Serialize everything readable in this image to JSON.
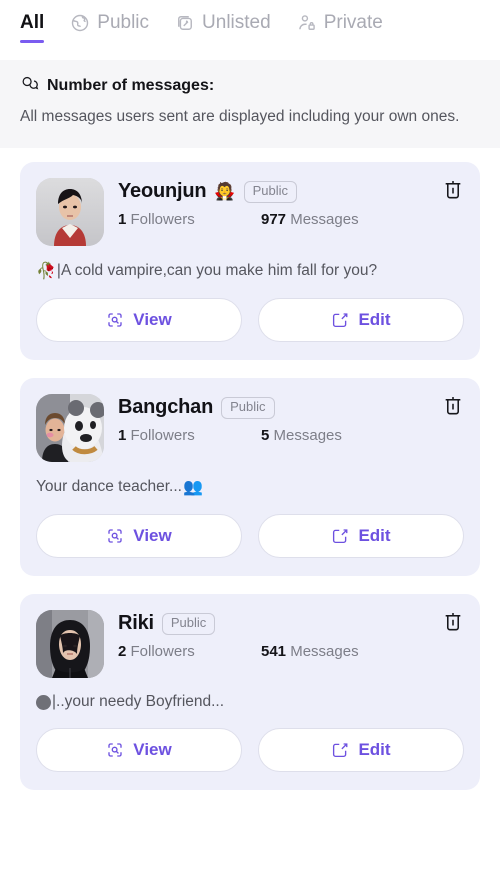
{
  "tabs": [
    {
      "label": "All",
      "icon": "",
      "active": true
    },
    {
      "label": "Public",
      "icon": "globe-icon",
      "active": false
    },
    {
      "label": "Unlisted",
      "icon": "unlisted-link-icon",
      "active": false
    },
    {
      "label": "Private",
      "icon": "person-lock-icon",
      "active": false
    }
  ],
  "banner": {
    "icon": "speech-bubbles-icon",
    "title": "Number of messages:",
    "subtitle": "All messages users sent are displayed including your own ones."
  },
  "colors": {
    "accent": "#7a5cf0",
    "button_text": "#6d51e0",
    "card_bg": "#eeeffa",
    "banner_bg": "#f6f6f8",
    "page_bg": "#ffffff",
    "muted_text": "#7d7e88"
  },
  "actions": {
    "view_label": "View",
    "view_icon": "view-square-magnifier-icon",
    "edit_label": "Edit",
    "edit_icon": "edit-pencil-square-icon",
    "delete_icon": "trash-icon"
  },
  "labels": {
    "followers": "Followers",
    "messages": "Messages"
  },
  "characters": [
    {
      "name": "Yeounjun",
      "name_emoji": "🧛",
      "visibility": "Public",
      "followers": "1",
      "followers_label": "Followers",
      "messages": "977",
      "messages_label": "Messages",
      "description": "|A cold vampire,can you make him fall for you?",
      "description_emoji": "🥀",
      "description_emoji_position": "start",
      "avatar": "yeounjun-avatar"
    },
    {
      "name": "Bangchan",
      "name_emoji": "",
      "visibility": "Public",
      "followers": "1",
      "followers_label": "Followers",
      "messages": "5",
      "messages_label": "Messages",
      "description": "Your dance teacher...",
      "description_emoji": "👥",
      "description_emoji_position": "end",
      "avatar": "bangchan-avatar"
    },
    {
      "name": "Riki",
      "name_emoji": "",
      "visibility": "Public",
      "followers": "2",
      "followers_label": "Followers",
      "messages": "541",
      "messages_label": "Messages",
      "description": "|..your needy Boyfriend...",
      "description_emoji": "circle",
      "description_emoji_position": "start",
      "avatar": "riki-avatar"
    }
  ]
}
